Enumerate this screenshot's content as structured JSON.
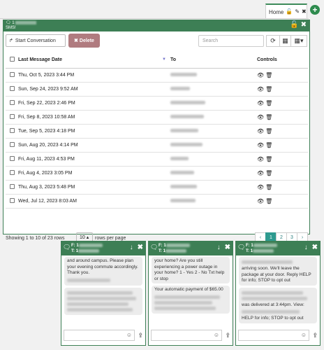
{
  "tabs": {
    "home_label": "Home"
  },
  "panel": {
    "title_prefix": "1",
    "subtitle": "SMS!"
  },
  "toolbar": {
    "start_label": "Start Conversation",
    "delete_label": "Delete",
    "search_placeholder": "Search"
  },
  "table": {
    "headers": {
      "date": "Last Message Date",
      "to": "To",
      "controls": "Controls"
    },
    "rows": [
      {
        "date": "Thu, Oct 5, 2023 3:44 PM"
      },
      {
        "date": "Sun, Sep 24, 2023 9:52 AM"
      },
      {
        "date": "Fri, Sep 22, 2023 2:46 PM"
      },
      {
        "date": "Fri, Sep 8, 2023 10:58 AM"
      },
      {
        "date": "Tue, Sep 5, 2023 4:18 PM"
      },
      {
        "date": "Sun, Aug 20, 2023 4:14 PM"
      },
      {
        "date": "Fri, Aug 11, 2023 4:53 PM"
      },
      {
        "date": "Fri, Aug 4, 2023 3:05 PM"
      },
      {
        "date": "Thu, Aug 3, 2023 5:48 PM"
      },
      {
        "date": "Wed, Jul 12, 2023 8:03 AM"
      }
    ]
  },
  "footer": {
    "info": "Showing 1 to 10 of 23 rows",
    "per_page": "10",
    "per_page_label": "rows per page",
    "pages": [
      "‹",
      "1",
      "2",
      "3",
      "›"
    ]
  },
  "chats": [
    {
      "from": "F: 1",
      "to": "T: 1",
      "messages": [
        "and around campus. Please plan your evening commute accordingly. Thank you."
      ]
    },
    {
      "from": "F: 1",
      "to": "T: 1",
      "messages": [
        "your home? Are you still experiencing a power outage in your home? 1 - Yes 2 - No Txt help or stop",
        "Your automatic payment of $65.00"
      ]
    },
    {
      "from": "F: 1",
      "to": "T: 1",
      "messages": [
        "arriving soon. We'll leave the package at your door. Reply HELP for info; STOP to opt out",
        "was delivered at 3:44pm. View:",
        "HELP for info; STOP to opt out"
      ]
    }
  ]
}
